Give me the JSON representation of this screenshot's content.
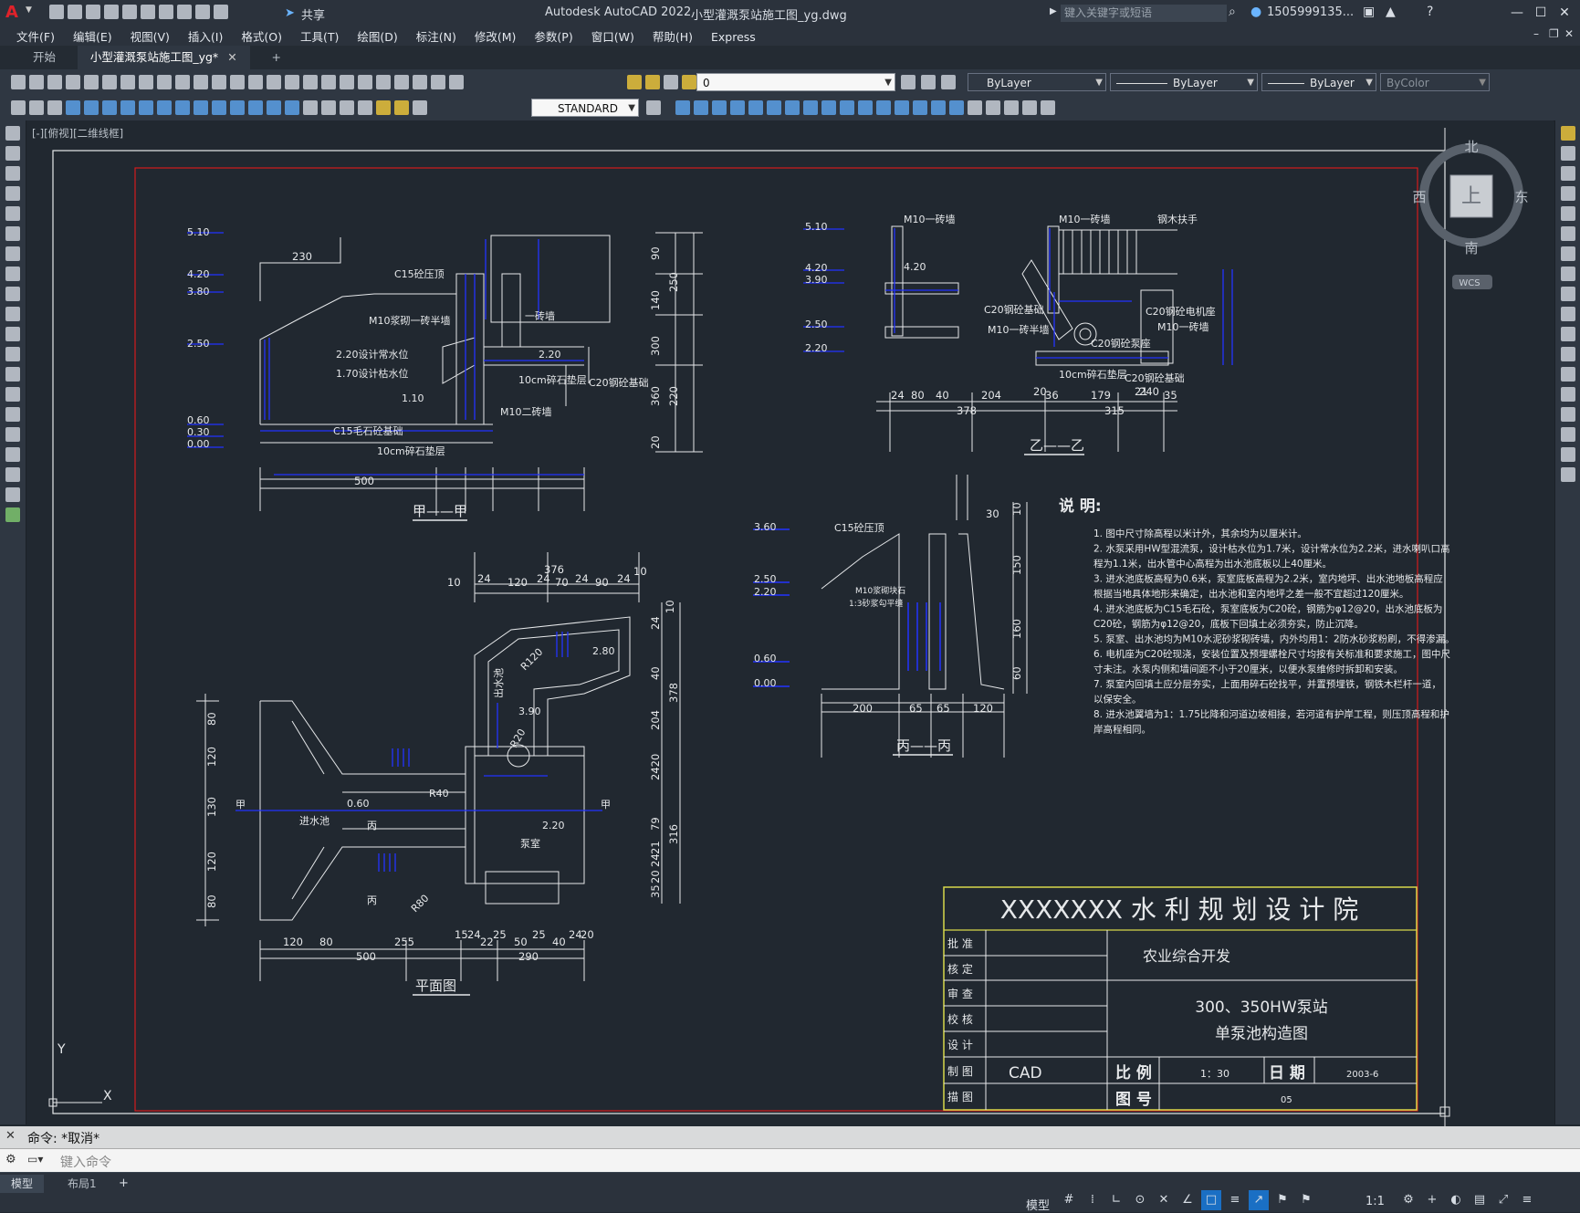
{
  "window": {
    "app_title": "Autodesk AutoCAD 2022",
    "file_title": "小型灌溉泵站施工图_yg.dwg",
    "search_placeholder": "键入关键字或短语",
    "user": "1505999135...",
    "share": "共享"
  },
  "menu": [
    "文件(F)",
    "编辑(E)",
    "视图(V)",
    "插入(I)",
    "格式(O)",
    "工具(T)",
    "绘图(D)",
    "标注(N)",
    "修改(M)",
    "参数(P)",
    "窗口(W)",
    "帮助(H)",
    "Express"
  ],
  "tabs": {
    "start": "开始",
    "doc": "小型灌溉泵站施工图_yg*",
    "add": "+"
  },
  "toolbar": {
    "layer_value": "0",
    "color_value": "ByLayer",
    "linetype_value": "ByLayer",
    "lineweight_value": "ByLayer",
    "plotstyle_value": "ByColor",
    "textstyle_value": "STANDARD"
  },
  "viewport": {
    "label": "[-][俯视][二维线框]",
    "compass": {
      "north": "北",
      "south": "南",
      "east": "东",
      "west": "西",
      "top": "上",
      "wcs": "WCS"
    }
  },
  "drawing": {
    "section_a": {
      "title": "甲——甲",
      "elev_labels": [
        "5.10",
        "4.20",
        "3.80",
        "2.50",
        "0.60",
        "0.30",
        "0.00"
      ],
      "notes": [
        "C15砼压顶",
        "M10浆砌一砖半墙",
        "一砖墙",
        "2.20设计常水位",
        "1.70设计枯水位",
        "2.20",
        "1.10",
        "C15毛石砼基础",
        "10cm碎石垫层",
        "10cm碎石垫层",
        "C20钢砼基础",
        "M10二砖墙"
      ],
      "dims": [
        "230",
        "500",
        "90",
        "140",
        "360",
        "220",
        "250",
        "300",
        "20"
      ]
    },
    "section_b": {
      "title": "乙——乙",
      "elev_labels": [
        "5.10",
        "4.20",
        "3.90",
        "2.50",
        "2.20"
      ],
      "notes": [
        "M10一砖墙",
        "M10一砖墙",
        "钢木扶手",
        "4.20",
        "C20钢砼基础",
        "M10一砖半墙",
        "C20钢砼电机座",
        "M10一砖墙",
        "C20钢砼泵座",
        "10cm碎石垫层",
        "C20钢砼基础"
      ],
      "dims": [
        "24",
        "80",
        "40",
        "204",
        "20",
        "36",
        "179",
        "21",
        "240",
        "35",
        "378",
        "315"
      ]
    },
    "section_c": {
      "title": "丙——丙",
      "elev_labels": [
        "3.60",
        "2.50",
        "2.20",
        "0.60",
        "0.00"
      ],
      "notes": [
        "C15砼压顶",
        "M10浆砌块石",
        "1:3砂浆勾平缝"
      ],
      "dims": [
        "30",
        "10",
        "150",
        "160",
        "60",
        "200",
        "65",
        "65",
        "120"
      ]
    },
    "plan": {
      "title": "平面图",
      "notes": [
        "出水池",
        "进水池",
        "泵室",
        "R120",
        "R20",
        "R40",
        "R80",
        "3.90",
        "2.80",
        "2.20",
        "0.60",
        "甲",
        "甲",
        "丙",
        "丙"
      ],
      "dims_top": [
        "10",
        "24",
        "120",
        "24",
        "70",
        "24",
        "90",
        "24",
        "10",
        "376"
      ],
      "dims_bottom": [
        "120",
        "80",
        "500",
        "255",
        "15",
        "24",
        "22",
        "25",
        "50",
        "25",
        "40",
        "24",
        "20",
        "290"
      ],
      "dims_left": [
        "80",
        "120",
        "130",
        "120",
        "80"
      ],
      "dims_right": [
        "10",
        "24",
        "40",
        "378",
        "204",
        "2420",
        "79",
        "316",
        "20",
        "24",
        "21",
        "35"
      ]
    },
    "notes_title": "说 明:",
    "notes": [
      "1. 图中尺寸除高程以米计外，其余均为以厘米计。",
      "2. 水泵采用HW型混流泵，设计枯水位为1.7米，设计常水位为2.2米，进水喇叭口高",
      "   程为1.1米，出水管中心高程为出水池底板以上40厘米。",
      "3. 进水池底板高程为0.6米，泵室底板高程为2.2米，室内地坪、出水池地板高程应",
      "   根据当地具体地形来确定，出水池和室内地坪之差一般不宜超过120厘米。",
      "4. 进水池底板为C15毛石砼，泵室底板为C20砼，钢筋为φ12@20，出水池底板为",
      "   C20砼，钢筋为φ12@20，底板下回填土必须夯实，防止沉降。",
      "5. 泵室、出水池均为M10水泥砂浆砌砖墙，内外均用1：2防水砂浆粉刷，不得渗漏。",
      "6. 电机座为C20砼现浇，安装位置及预埋螺栓尺寸均按有关标准和要求施工，图中尺",
      "   寸未注。水泵内侧和墙间距不小于20厘米，以便水泵维修时拆卸和安装。",
      "7. 泵室内回填土应分层夯实，上面用碎石砼找平，并置预埋铁，钢铁木栏杆一道，",
      "   以保安全。",
      "8. 进水池翼墙为1：1.75比降和河道边坡相接，若河道有护岸工程，则压顶高程和护",
      "   岸高程相同。"
    ],
    "titleblock": {
      "org": "XXXXXXX 水 利 规 划 设 计 院",
      "roles": [
        "批 准",
        "核 定",
        "审 查",
        "校 核",
        "设 计",
        "制 图",
        "描 图"
      ],
      "project": "农业综合开发",
      "drawing_name_1": "300、350HW泵站",
      "drawing_name_2": "单泵池构造图",
      "drafter": "CAD",
      "scale_label": "比 例",
      "scale_value": "1：30",
      "date_label": "日 期",
      "date_value": "2003-6",
      "no_label": "图 号",
      "no_value": "05"
    }
  },
  "command": {
    "history": "命令: *取消*",
    "placeholder": "键入命令"
  },
  "status": {
    "model_tab": "模型",
    "layout_tab": "布局1",
    "add_tab": "+",
    "model_label": "模型",
    "scale": "1:1"
  },
  "colors": {
    "background": "#212830",
    "drawing_line": "#e6e8ea",
    "dim_blue": "#2233ff",
    "border_red": "#d41c1c",
    "titleblock_yellow": "#d8d84a"
  }
}
